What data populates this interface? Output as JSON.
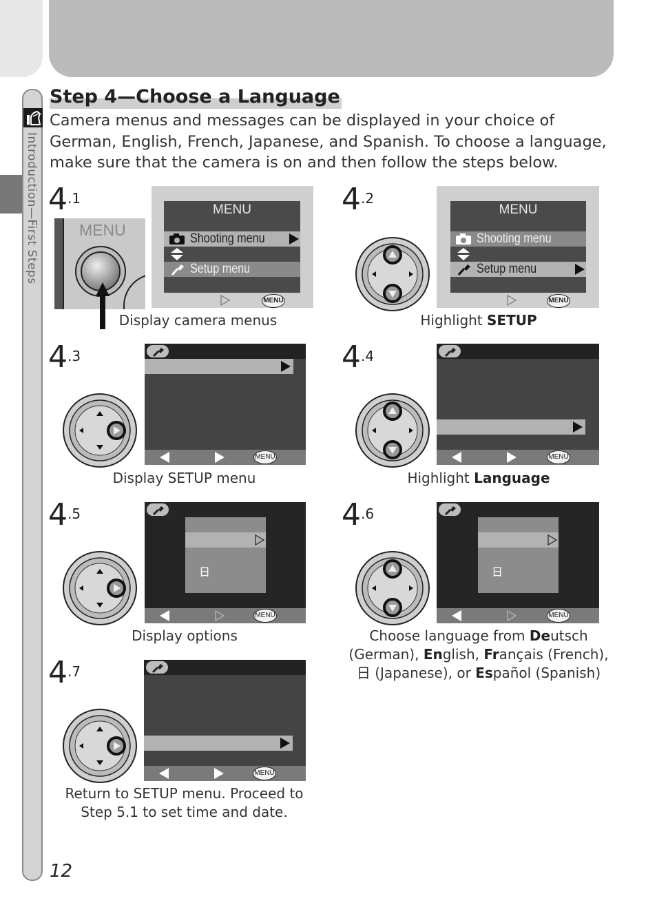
{
  "page": {
    "section_tab": "Introduction—First Steps",
    "page_number": "12",
    "title": "Step 4—Choose a Language",
    "intro": "Camera menus and messages can be displayed in your choice of German, English, French, Japanese, and Spanish.  To choose a language, make sure that the camera is on and then follow the steps below."
  },
  "steps": [
    {
      "num": "4",
      "sub": ".1",
      "caption": "Display camera menus",
      "button_label": "MENU",
      "screen": {
        "title": "MENU",
        "items": [
          "Shooting menu",
          "Setup menu"
        ],
        "menu_badge": "MENU"
      }
    },
    {
      "num": "4",
      "sub": ".2",
      "caption_pre": "Highlight ",
      "caption_bold": "SETUP",
      "screen": {
        "title": "MENU",
        "items": [
          "Shooting menu",
          "Setup menu"
        ],
        "menu_badge": "MENU"
      }
    },
    {
      "num": "4",
      "sub": ".3",
      "caption": "Display SETUP menu",
      "menu_badge": "MENU"
    },
    {
      "num": "4",
      "sub": ".4",
      "caption_pre": "Highlight ",
      "caption_bold": "Language",
      "menu_badge": "MENU"
    },
    {
      "num": "4",
      "sub": ".5",
      "caption": "Display options",
      "menu_badge": "MENU",
      "kanji": "日"
    },
    {
      "num": "4",
      "sub": ".6",
      "menu_badge": "MENU",
      "kanji": "日",
      "caption_parts": [
        {
          "t": "Choose language from ",
          "b": false
        },
        {
          "t": "De",
          "b": true
        },
        {
          "t": "utsch (German), ",
          "b": false
        },
        {
          "t": "En",
          "b": true
        },
        {
          "t": "glish, ",
          "b": false
        },
        {
          "t": "Fr",
          "b": true
        },
        {
          "t": "ançais (French), ",
          "b": false
        },
        {
          "t": "日",
          "b": false
        },
        {
          "t": " (Japanese), or ",
          "b": false
        },
        {
          "t": "Es",
          "b": true
        },
        {
          "t": "pañol (Spanish)",
          "b": false
        }
      ]
    },
    {
      "num": "4",
      "sub": ".7",
      "caption": "Return to SETUP menu.  Proceed to Step 5.1 to set time and date.",
      "menu_badge": "MENU"
    }
  ]
}
